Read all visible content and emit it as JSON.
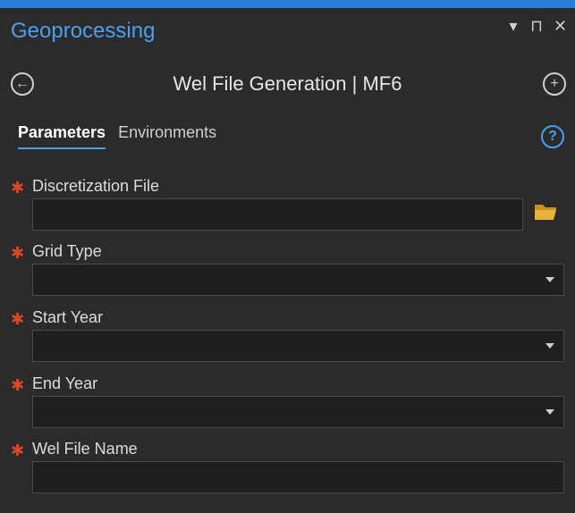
{
  "pane": {
    "title": "Geoprocessing"
  },
  "header_icons": [
    "options-menu-icon",
    "pin-icon",
    "close-icon"
  ],
  "header_glyphs": {
    "menu": "▾",
    "pin": "⊓",
    "close": "✕"
  },
  "tool": {
    "title": "Wel File Generation | MF6",
    "back_glyph": "←",
    "add_glyph": "+"
  },
  "tabs": [
    {
      "label": "Parameters",
      "active": true
    },
    {
      "label": "Environments",
      "active": false
    }
  ],
  "help_glyph": "?",
  "params": [
    {
      "label": "Discretization File",
      "required": true,
      "type": "file",
      "value": ""
    },
    {
      "label": "Grid Type",
      "required": true,
      "type": "dropdown",
      "value": ""
    },
    {
      "label": "Start Year",
      "required": true,
      "type": "dropdown",
      "value": ""
    },
    {
      "label": "End Year",
      "required": true,
      "type": "dropdown",
      "value": ""
    },
    {
      "label": "Wel File Name",
      "required": true,
      "type": "text",
      "value": ""
    }
  ],
  "colors": {
    "accent": "#2d7fd6",
    "link": "#4aa0f0",
    "required": "#d64a2b",
    "folder": "#e8b13a"
  },
  "required_glyph": "✱"
}
